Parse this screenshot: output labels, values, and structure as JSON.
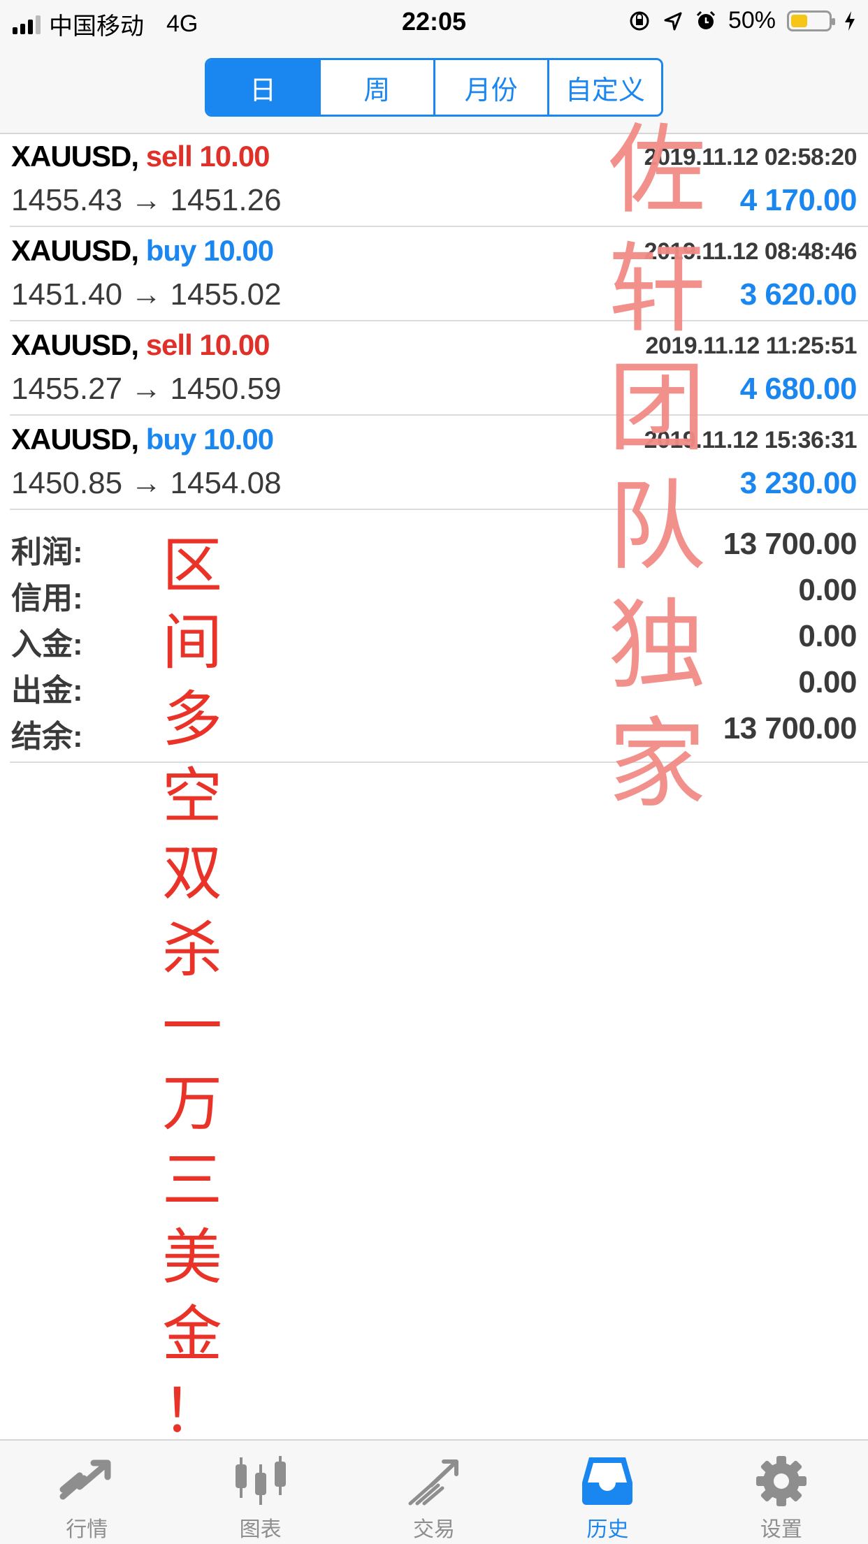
{
  "status_bar": {
    "carrier": "中国移动",
    "network": "4G",
    "time": "22:05",
    "battery": "50%",
    "battery_level": 0.5,
    "icons": [
      "signal-icon",
      "orientation-lock-icon",
      "location-icon",
      "alarm-icon",
      "battery-icon",
      "charging-icon"
    ]
  },
  "period_tabs": [
    {
      "label": "日",
      "active": true
    },
    {
      "label": "周",
      "active": false
    },
    {
      "label": "月份",
      "active": false
    },
    {
      "label": "自定义",
      "active": false
    }
  ],
  "deals": [
    {
      "symbol": "XAUUSD,",
      "direction": "sell 10.00",
      "type": "sell",
      "time": "2019.11.12 02:58:20",
      "prices": "1455.43 → 1451.26",
      "profit": "4 170.00"
    },
    {
      "symbol": "XAUUSD,",
      "direction": "buy 10.00",
      "type": "buy",
      "time": "2019.11.12 08:48:46",
      "prices": "1451.40 → 1455.02",
      "profit": "3 620.00"
    },
    {
      "symbol": "XAUUSD,",
      "direction": "sell 10.00",
      "type": "sell",
      "time": "2019.11.12 11:25:51",
      "prices": "1455.27 → 1450.59",
      "profit": "4 680.00"
    },
    {
      "symbol": "XAUUSD,",
      "direction": "buy 10.00",
      "type": "buy",
      "time": "2019.11.12 15:36:31",
      "prices": "1450.85 → 1454.08",
      "profit": "3 230.00"
    }
  ],
  "summary": [
    {
      "label": "利润:",
      "value": "13 700.00"
    },
    {
      "label": "信用:",
      "value": "0.00"
    },
    {
      "label": "入金:",
      "value": "0.00"
    },
    {
      "label": "出金:",
      "value": "0.00"
    },
    {
      "label": "结余:",
      "value": "13 700.00"
    }
  ],
  "overlay_text": {
    "left": [
      "区",
      "间",
      "多",
      "空",
      "双",
      "杀",
      "一",
      "万",
      "三",
      "美",
      "金",
      "！"
    ],
    "right": [
      "佐",
      "轩",
      "团",
      "队",
      "独",
      "家"
    ]
  },
  "tab_bar": [
    {
      "label": "行情",
      "icon": "quotes-icon",
      "active": false
    },
    {
      "label": "图表",
      "icon": "chart-icon",
      "active": false
    },
    {
      "label": "交易",
      "icon": "trade-icon",
      "active": false
    },
    {
      "label": "历史",
      "icon": "history-icon",
      "active": true
    },
    {
      "label": "设置",
      "icon": "settings-icon",
      "active": false
    }
  ],
  "colors": {
    "accent": "#1a86f0",
    "sell": "#e0302a",
    "buy": "#1a86f0",
    "handwriting_left": "#ea3328",
    "handwriting_right": "#f28b86"
  }
}
